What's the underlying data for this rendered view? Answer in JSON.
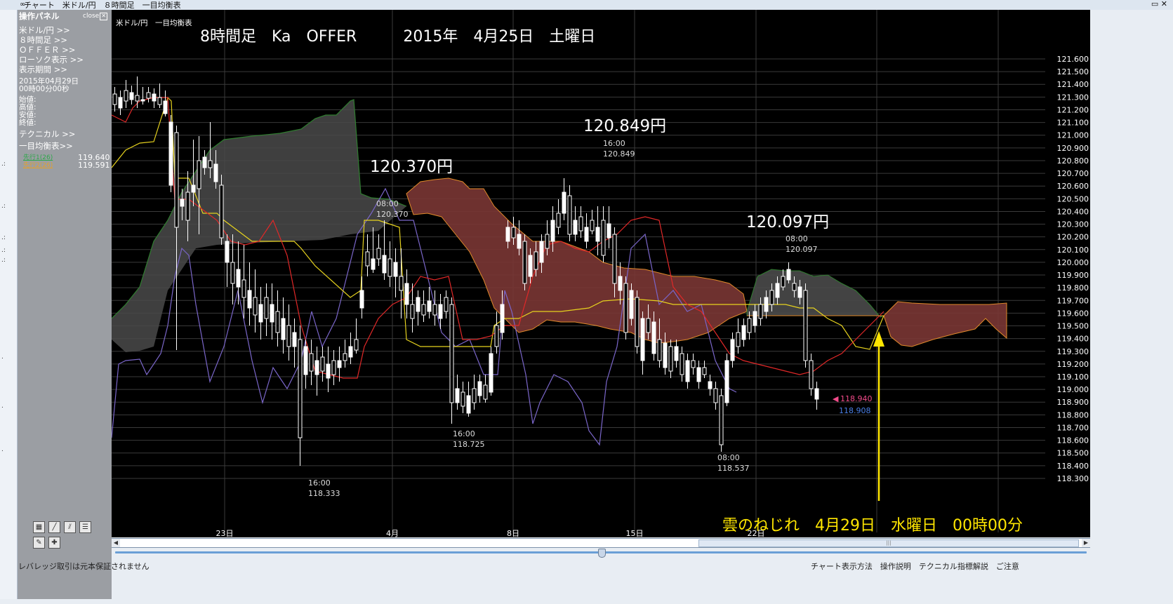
{
  "window": {
    "title": "チャート　米ドル/円　８時間足　一目均衡表"
  },
  "left_strip_marks": [
    ".:",
    ".:",
    ".:",
    ".:",
    ".:",
    ".",
    ".",
    "."
  ],
  "panel": {
    "header": "操作パネル",
    "close_label": "close",
    "items": [
      "米ドル/円 >>",
      "８時間足 >>",
      "ＯＦＦＥＲ >>",
      "ローソク表示 >>",
      "表示期間 >>"
    ],
    "date": "2015年04月29日",
    "time": "00時00分00秒",
    "ohlc_labels": [
      "始値:",
      "高値:",
      "安値:",
      "終値:"
    ],
    "technical": "テクニカル >>",
    "ichimoku": "一目均衡表>>",
    "senkou1_label": "先行1(26)",
    "senkou1_value": "119.640",
    "senkou2_label": "先行2(26)",
    "senkou2_value": "119.591"
  },
  "colors": {
    "tenkan": "#e02828",
    "kijun": "#e6d21e",
    "chikou": "#7a66c9",
    "cloud_bull": "#4a4a4a",
    "cloud_bear": "#7a3634",
    "senkou1_edge": "#2f7d2f",
    "senkou2_edge": "#e08a2a",
    "annotation": "#ffe600"
  },
  "chart": {
    "header_left": "米ドル/円　一目均衡表",
    "title": "8時間足　Ka　OFFER　　　2015年　4月25日　土曜日",
    "callouts": [
      {
        "text": "120.370円"
      },
      {
        "text": "120.849円"
      },
      {
        "text": "120.097円"
      }
    ],
    "marks": [
      {
        "time": "08:00",
        "price": "120.370"
      },
      {
        "time": "16:00",
        "price": "120.849"
      },
      {
        "time": "08:00",
        "price": "120.097"
      },
      {
        "time": "16:00",
        "price": "118.333"
      },
      {
        "time": "16:00",
        "price": "118.725"
      },
      {
        "time": "08:00",
        "price": "118.537"
      }
    ],
    "current_price_pink": "118.940",
    "current_price_blue": "118.908",
    "annotation": "雲のねじれ　4月29日　水曜日　00時00分",
    "x_ticks": [
      "23日",
      "4月",
      "8日",
      "15日",
      "22日"
    ]
  },
  "chart_data": {
    "type": "candlestick",
    "symbol": "米ドル/円",
    "timeframe": "8時間足",
    "y_ticks": [
      121.6,
      121.5,
      121.4,
      121.3,
      121.2,
      121.1,
      121.0,
      120.9,
      120.8,
      120.7,
      120.6,
      120.5,
      120.4,
      120.3,
      120.2,
      120.1,
      120.0,
      119.9,
      119.8,
      119.7,
      119.6,
      119.5,
      119.4,
      119.3,
      119.2,
      119.1,
      119.0,
      118.9,
      118.8,
      118.7,
      118.6,
      118.5,
      118.4,
      118.3
    ],
    "ylim": [
      118.2,
      121.7
    ],
    "grid": true
  },
  "status": {
    "left": "レバレッジ取引は元本保証されません",
    "right": "チャート表示方法　操作説明　テクニカル指標解説　ご注意"
  }
}
